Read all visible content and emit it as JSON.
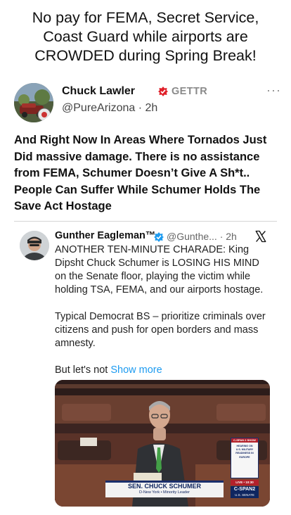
{
  "headline": {
    "line1": "No pay for FEMA, Secret Service,",
    "line2": "Coast Guard while airports are",
    "line3": "CROWDED during Spring Break!"
  },
  "post": {
    "author_name": "Chuck Lawler",
    "source": "GETTR",
    "handle": "@PureArizona",
    "separator": "·",
    "time": "2h",
    "more_label": "···",
    "body": "And Right Now In Areas Where Tornados Just Did massive damage. There is no assistance from FEMA, Schumer Doesn’t Give A Sh*t.. People Can Suffer While Schumer Holds The Save Act Hostage"
  },
  "embed": {
    "author_name": "Gunther Eagleman™",
    "handle": "@Gunthe...",
    "separator": "·",
    "time": "2h",
    "platform_icon": "x-logo-icon",
    "paragraph1": "ANOTHER TEN-MINUTE CHARADE: King Dipsht Chuck Schumer is LOSING HIS MIND on the Senate floor, playing the victim while holding TSA, FEMA, and our airports hostage.",
    "paragraph2": "Typical Democrat BS – prioritize criminals over citizens and push for open borders and mass amnesty.",
    "paragraph3_prefix": "But let's not ",
    "show_more": "Show more"
  },
  "video": {
    "chyron_name": "SEN. CHUCK SCHUMER",
    "chyron_sub": "D-New York  •  Minority Leader",
    "side_tag": "C-SPAN 2 SHOW",
    "side_line1": "HEARING ON",
    "side_line2": "U.S. MILITARY",
    "side_line3": "READINESS IN",
    "side_line4": "EUROPE",
    "live": "LIVE  •  10:30",
    "network": "C-SPAN2",
    "network_sub": "U.S. SENATE"
  },
  "colors": {
    "link": "#1d9bf0",
    "gettr_badge": "#e0202a",
    "verified": "#1d9bf0",
    "cspan_blue": "#0f2660"
  }
}
